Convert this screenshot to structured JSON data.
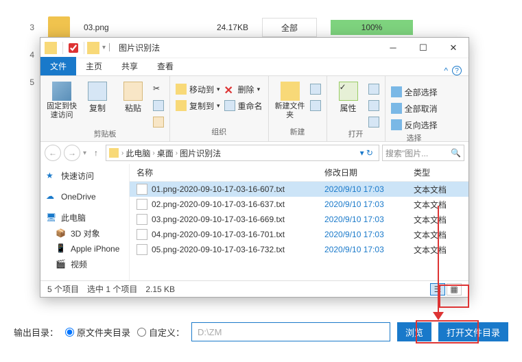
{
  "bg": {
    "rows": [
      {
        "num": "3",
        "name": "03.png",
        "size": "24.17KB",
        "all": "全部",
        "pct": "100%"
      },
      {
        "num": "4",
        "name": "",
        "size": "",
        "all": "",
        "pct": ""
      },
      {
        "num": "5",
        "name": "",
        "size": "",
        "all": "",
        "pct": ""
      }
    ]
  },
  "dialog": {
    "title": "图片识别法",
    "tabs": {
      "file": "文件",
      "home": "主页",
      "share": "共享",
      "view": "查看"
    },
    "ribbon": {
      "pin": "固定到快速访问",
      "copy": "复制",
      "paste": "粘贴",
      "cut": "剪切",
      "clipboard": "剪贴板",
      "moveto": "移动到",
      "copyto": "复制到",
      "delete": "删除",
      "rename": "重命名",
      "organize": "组织",
      "newfolder": "新建文件夹",
      "new": "新建",
      "properties": "属性",
      "open": "打开",
      "selectall": "全部选择",
      "selectnone": "全部取消",
      "invert": "反向选择",
      "select": "选择"
    },
    "path": {
      "pc": "此电脑",
      "desktop": "桌面",
      "folder": "图片识别法"
    },
    "search_ph": "搜索\"图片...",
    "tree": {
      "quick": "快速访问",
      "onedrive": "OneDrive",
      "pc": "此电脑",
      "3d": "3D 对象",
      "iphone": "Apple iPhone",
      "video": "视频"
    },
    "cols": {
      "name": "名称",
      "date": "修改日期",
      "type": "类型"
    },
    "files": [
      {
        "name": "01.png-2020-09-10-17-03-16-607.txt",
        "date": "2020/9/10 17:03",
        "type": "文本文档",
        "sel": true
      },
      {
        "name": "02.png-2020-09-10-17-03-16-637.txt",
        "date": "2020/9/10 17:03",
        "type": "文本文档",
        "sel": false
      },
      {
        "name": "03.png-2020-09-10-17-03-16-669.txt",
        "date": "2020/9/10 17:03",
        "type": "文本文档",
        "sel": false
      },
      {
        "name": "04.png-2020-09-10-17-03-16-701.txt",
        "date": "2020/9/10 17:03",
        "type": "文本文档",
        "sel": false
      },
      {
        "name": "05.png-2020-09-10-17-03-16-732.txt",
        "date": "2020/9/10 17:03",
        "type": "文本文档",
        "sel": false
      }
    ],
    "status": {
      "count": "5 个项目",
      "selected": "选中 1 个项目",
      "size": "2.15 KB"
    }
  },
  "bottom": {
    "label": "输出目录：",
    "orig": "原文件夹目录",
    "custom": "自定义：",
    "path": "D:\\ZM",
    "browse": "浏览",
    "open": "打开文件目录"
  }
}
